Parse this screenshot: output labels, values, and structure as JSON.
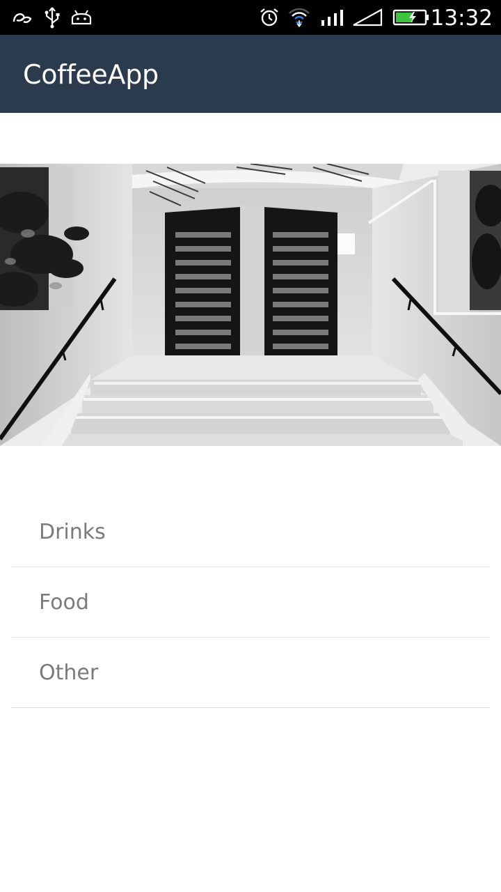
{
  "status_bar": {
    "time": "13:32",
    "left_icons": [
      "notification-app-icon",
      "usb-icon",
      "android-debug-icon"
    ],
    "right_icons": [
      "alarm-icon",
      "wifi-icon",
      "signal-icon",
      "signal-empty-icon",
      "battery-charging-icon"
    ],
    "battery_color": "#3ec43e"
  },
  "app_bar": {
    "title": "CoffeeApp",
    "background": "#2c3a4d"
  },
  "menu": {
    "items": [
      {
        "label": "Drinks"
      },
      {
        "label": "Food"
      },
      {
        "label": "Other"
      }
    ]
  }
}
